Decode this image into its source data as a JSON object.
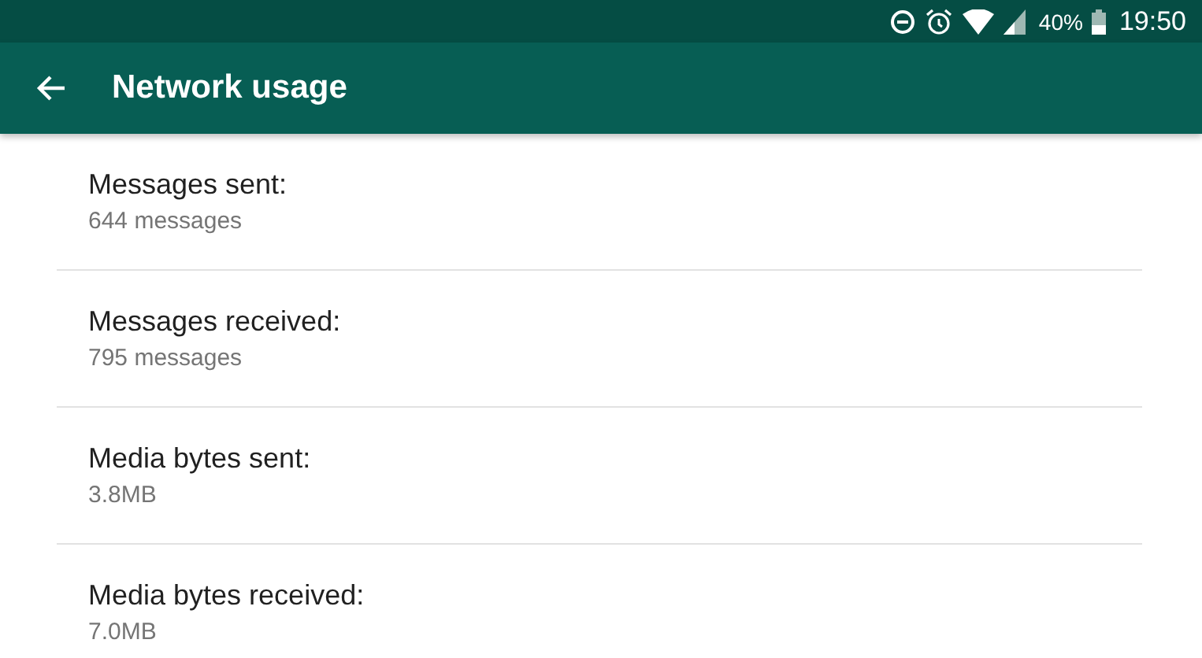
{
  "status_bar": {
    "battery": "40%",
    "time": "19:50"
  },
  "app_bar": {
    "title": "Network usage"
  },
  "items": [
    {
      "label": "Messages sent:",
      "value": "644 messages"
    },
    {
      "label": "Messages received:",
      "value": "795 messages"
    },
    {
      "label": "Media bytes sent:",
      "value": "3.8MB"
    },
    {
      "label": "Media bytes received:",
      "value": "7.0MB"
    }
  ]
}
